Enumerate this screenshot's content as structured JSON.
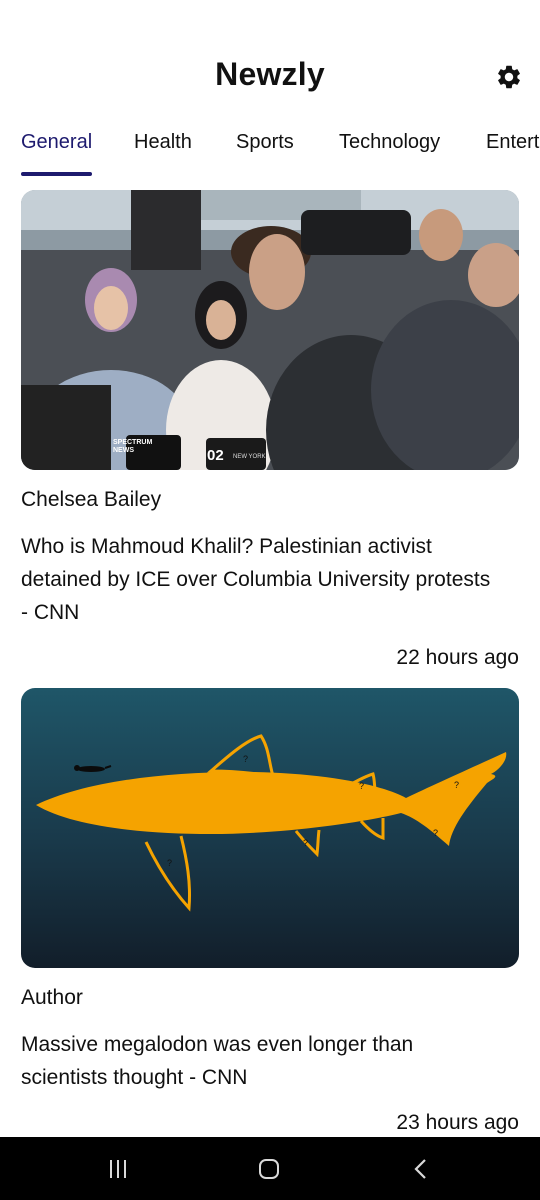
{
  "app": {
    "title": "Newzly"
  },
  "icons": {
    "settings": "gear-icon",
    "recents": "recents-icon",
    "home": "home-icon",
    "back": "back-icon"
  },
  "tabs": [
    {
      "label": "General",
      "active": true
    },
    {
      "label": "Health",
      "active": false
    },
    {
      "label": "Sports",
      "active": false
    },
    {
      "label": "Technology",
      "active": false
    },
    {
      "label": "Entert",
      "active": false
    }
  ],
  "articles": [
    {
      "image": "photo-reporters-crowd",
      "image_text": {
        "logo_1": "SPECTRUM NEWS",
        "logo_2": "02",
        "logo_2_sub": "NEW YORK"
      },
      "author": "Chelsea Bailey",
      "headline": "Who is Mahmoud Khalil? Palestinian activist detained by ICE over Columbia University protests - CNN",
      "time": "22 hours ago"
    },
    {
      "image": "illustration-megalodon-silhouette",
      "image_text": {
        "mark": "?"
      },
      "author": "Author",
      "headline": "Massive megalodon was even longer than scientists thought - CNN",
      "time": "23 hours ago"
    }
  ],
  "colors": {
    "accent": "#1d1a6e",
    "shark": "#f5a300",
    "ocean_top": "#1f5668",
    "ocean_bottom": "#121e2a",
    "nav_bar": "#000000"
  }
}
